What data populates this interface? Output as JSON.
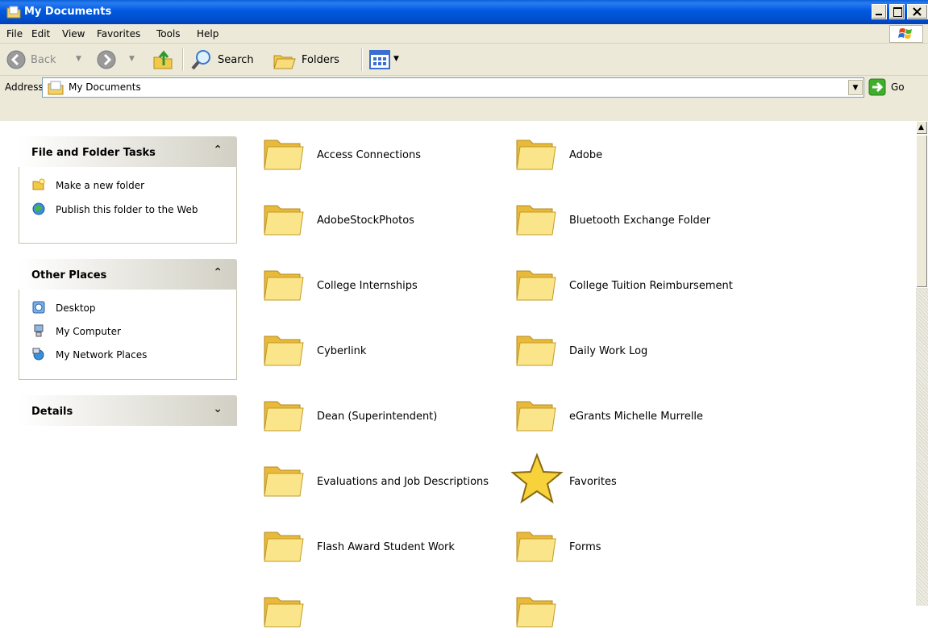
{
  "window": {
    "title": "My Documents"
  },
  "menu": [
    "File",
    "Edit",
    "View",
    "Favorites",
    "Tools",
    "Help"
  ],
  "toolbar": {
    "back_label": "Back",
    "search_label": "Search",
    "folders_label": "Folders"
  },
  "address": {
    "label": "Address",
    "value": "My Documents",
    "go_label": "Go"
  },
  "panels": {
    "tasks": {
      "title": "File and Folder Tasks",
      "items": [
        "Make a new folder",
        "Publish this folder to the Web"
      ]
    },
    "places": {
      "title": "Other Places",
      "items": [
        "Desktop",
        "My Computer",
        "My Network Places"
      ]
    },
    "details": {
      "title": "Details"
    }
  },
  "files": [
    "Access Connections",
    "Adobe",
    "AdobeStockPhotos",
    "Bluetooth Exchange Folder",
    "College Internships",
    "College Tuition Reimbursement",
    "Cyberlink",
    "Daily Work Log",
    "Dean (Superintendent)",
    "eGrants Michelle Murrelle",
    "Evaluations and Job Descriptions",
    "Favorites",
    "Flash Award Student Work",
    "Forms"
  ]
}
